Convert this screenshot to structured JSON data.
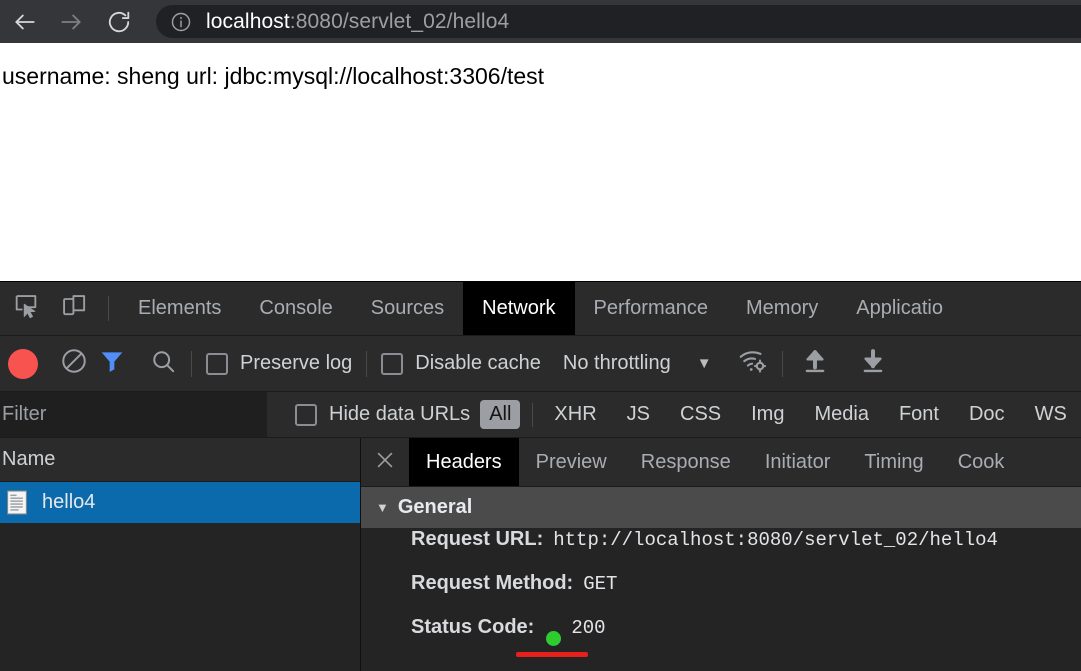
{
  "browser": {
    "back_icon": "arrow-left-icon",
    "forward_icon": "arrow-right-icon",
    "reload_icon": "reload-icon",
    "site_info_icon": "info-circle-icon",
    "url_host": "localhost",
    "url_rest": ":8080/servlet_02/hello4",
    "url_full": "localhost:8080/servlet_02/hello4",
    "annotation_color": "#e8201b"
  },
  "page": {
    "body_text": "username: sheng url: jdbc:mysql://localhost:3306/test"
  },
  "devtools": {
    "inspect_icon": "inspect-element-icon",
    "device_toggle_icon": "device-toolbar-icon",
    "tabs": [
      {
        "label": "Elements",
        "active": false
      },
      {
        "label": "Console",
        "active": false
      },
      {
        "label": "Sources",
        "active": false
      },
      {
        "label": "Network",
        "active": true
      },
      {
        "label": "Performance",
        "active": false
      },
      {
        "label": "Memory",
        "active": false
      },
      {
        "label": "Applicatio",
        "active": false
      }
    ],
    "network_controls": {
      "record_icon": "record-circle-icon",
      "clear_icon": "clear-prohibited-icon",
      "filter_icon": "funnel-filter-icon",
      "search_icon": "search-magnifier-icon",
      "preserve_log_label": "Preserve log",
      "preserve_log_checked": false,
      "disable_cache_label": "Disable cache",
      "disable_cache_checked": false,
      "throttling_value": "No throttling",
      "throttling_caret": "▼",
      "network_conditions_icon": "wifi-gear-icon",
      "import_har_icon": "upload-arrow-icon",
      "export_har_icon": "download-arrow-icon"
    },
    "filter_bar": {
      "filter_placeholder": "Filter",
      "filter_value": "",
      "hide_data_urls_label": "Hide data URLs",
      "hide_data_urls_checked": false,
      "resource_types": [
        {
          "label": "All",
          "active": true
        },
        {
          "label": "XHR",
          "active": false
        },
        {
          "label": "JS",
          "active": false
        },
        {
          "label": "CSS",
          "active": false
        },
        {
          "label": "Img",
          "active": false
        },
        {
          "label": "Media",
          "active": false
        },
        {
          "label": "Font",
          "active": false
        },
        {
          "label": "Doc",
          "active": false
        },
        {
          "label": "WS",
          "active": false
        }
      ]
    },
    "requests": {
      "column_name": "Name",
      "rows": [
        {
          "name": "hello4",
          "icon": "document-file-icon",
          "selected": true
        }
      ],
      "selected_color": "#0b6aab"
    },
    "details": {
      "close_icon": "close-x-icon",
      "tabs": [
        {
          "label": "Headers",
          "active": true
        },
        {
          "label": "Preview",
          "active": false
        },
        {
          "label": "Response",
          "active": false
        },
        {
          "label": "Initiator",
          "active": false
        },
        {
          "label": "Timing",
          "active": false
        },
        {
          "label": "Cook",
          "active": false
        }
      ],
      "general_section": {
        "caret": "▼",
        "title": "General",
        "rows": [
          {
            "key": "Request URL:",
            "value": "http://localhost:8080/servlet_02/hello4"
          },
          {
            "key": "Request Method:",
            "value": "GET"
          },
          {
            "key": "Status Code:",
            "value": "200",
            "status_color": "#2ecc2e"
          }
        ]
      }
    }
  }
}
